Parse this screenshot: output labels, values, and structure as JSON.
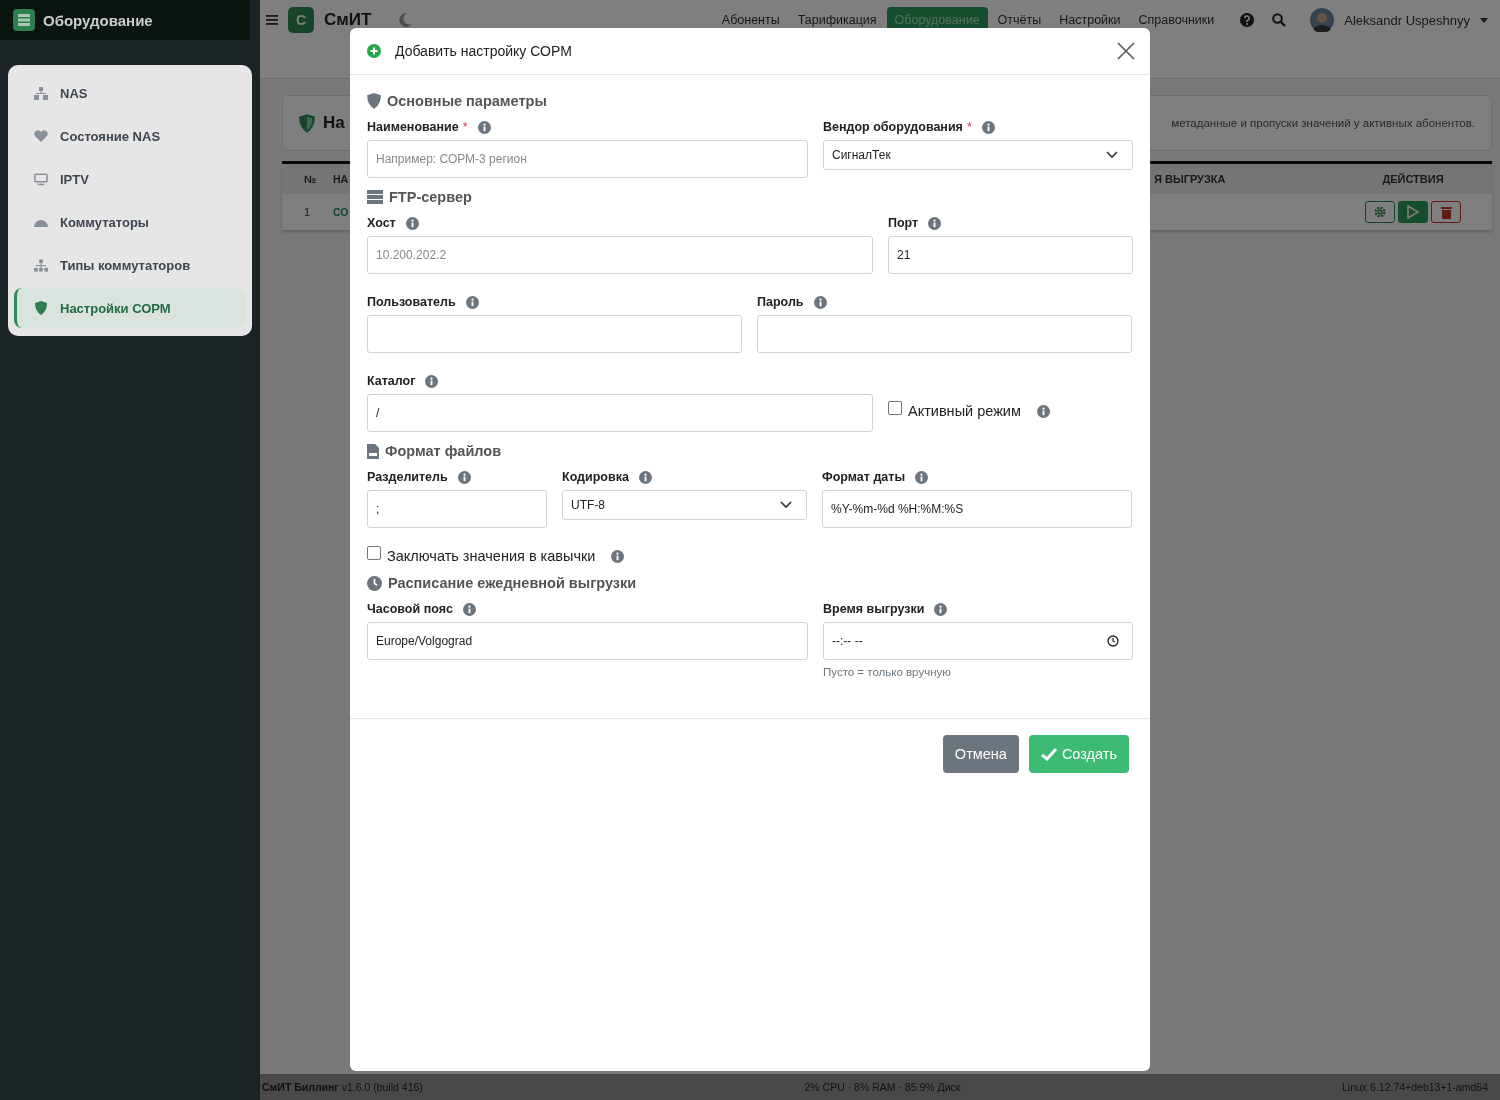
{
  "sidebar": {
    "brand": "Оборудование",
    "items": [
      {
        "label": "NAS",
        "selected": false
      },
      {
        "label": "Состояние NAS",
        "selected": false
      },
      {
        "label": "IPTV",
        "selected": false
      },
      {
        "label": "Коммутаторы",
        "selected": false
      },
      {
        "label": "Типы коммутаторов",
        "selected": false
      },
      {
        "label": "Настройки СОРМ",
        "selected": true
      }
    ]
  },
  "topbar": {
    "logo_letter": "С",
    "app_name": "СмИТ",
    "nav": [
      {
        "label": "Абоненты",
        "selected": false
      },
      {
        "label": "Тарификация",
        "selected": false
      },
      {
        "label": "Оборудование",
        "selected": true
      },
      {
        "label": "Отчёты",
        "selected": false
      },
      {
        "label": "Настройки",
        "selected": false
      },
      {
        "label": "Справочники",
        "selected": false
      }
    ],
    "user": "Aleksandr Uspeshnyy"
  },
  "page": {
    "card_title": "На",
    "card_note": "метаданные и пропуски значений у активных абонентов.",
    "table": {
      "columns": [
        "№",
        "НА",
        "Я ВЫГРУЗКА",
        "ДЕЙСТВИЯ"
      ],
      "rows": [
        {
          "cells": [
            "1",
            "СО"
          ]
        }
      ]
    }
  },
  "footer": {
    "left": "**СмИТ Биллинг** v1.6.0 (build 416)",
    "center": "2% CPU · 8% RAM · 85.9% Диск",
    "right": "Linux 6.12.74+deb13+1-amd64"
  },
  "modal": {
    "title": "Добавить настройку СОРМ",
    "sections": [
      {
        "title": "Основные параметры",
        "rows": [
          {
            "fields": [
              {
                "kind": "text",
                "label": "Наименование",
                "required_mark": "*",
                "placeholder": "Например: СОРМ-3 регион"
              },
              {
                "kind": "select",
                "label": "Вендор оборудования",
                "required_mark": "*",
                "value": "СигналТек"
              }
            ]
          }
        ]
      },
      {
        "title": "FTP-сервер",
        "rows": [
          {
            "fields": [
              {
                "kind": "text",
                "label": "Хост",
                "placeholder": "10.200.202.2"
              },
              {
                "kind": "text",
                "label": "Порт",
                "value": "21"
              }
            ]
          },
          {
            "fields": [
              {
                "kind": "text",
                "label": "Пользователь"
              },
              {
                "kind": "text",
                "label": "Пароль"
              }
            ]
          },
          {
            "fields": [
              {
                "kind": "text",
                "label": "Каталог",
                "value": "/"
              },
              {
                "kind": "checkbox",
                "label": "Активный режим",
                "checked": false
              }
            ]
          }
        ]
      },
      {
        "title": "Формат файлов",
        "rows": [
          {
            "fields": [
              {
                "kind": "text",
                "label": "Разделитель",
                "value": ";"
              },
              {
                "kind": "select",
                "label": "Кодировка",
                "value": "UTF-8"
              },
              {
                "kind": "text",
                "label": "Формат даты",
                "value": "%Y-%m-%d %H:%M:%S"
              }
            ]
          },
          {
            "fields": [
              {
                "kind": "checkbox",
                "label": "Заключать значения в кавычки",
                "checked": false
              }
            ]
          }
        ]
      },
      {
        "title": "Расписание ежедневной выгрузки",
        "rows": [
          {
            "fields": [
              {
                "kind": "text",
                "label": "Часовой пояс",
                "value": "Europe/Volgograd"
              },
              {
                "kind": "time",
                "label": "Время выгрузки",
                "value": "--:-- --",
                "hint": "Пусто = только вручную"
              }
            ]
          }
        ]
      }
    ],
    "buttons": [
      {
        "kind": "secondary",
        "label": "Отмена"
      },
      {
        "kind": "primary",
        "label": "Создать"
      }
    ]
  }
}
